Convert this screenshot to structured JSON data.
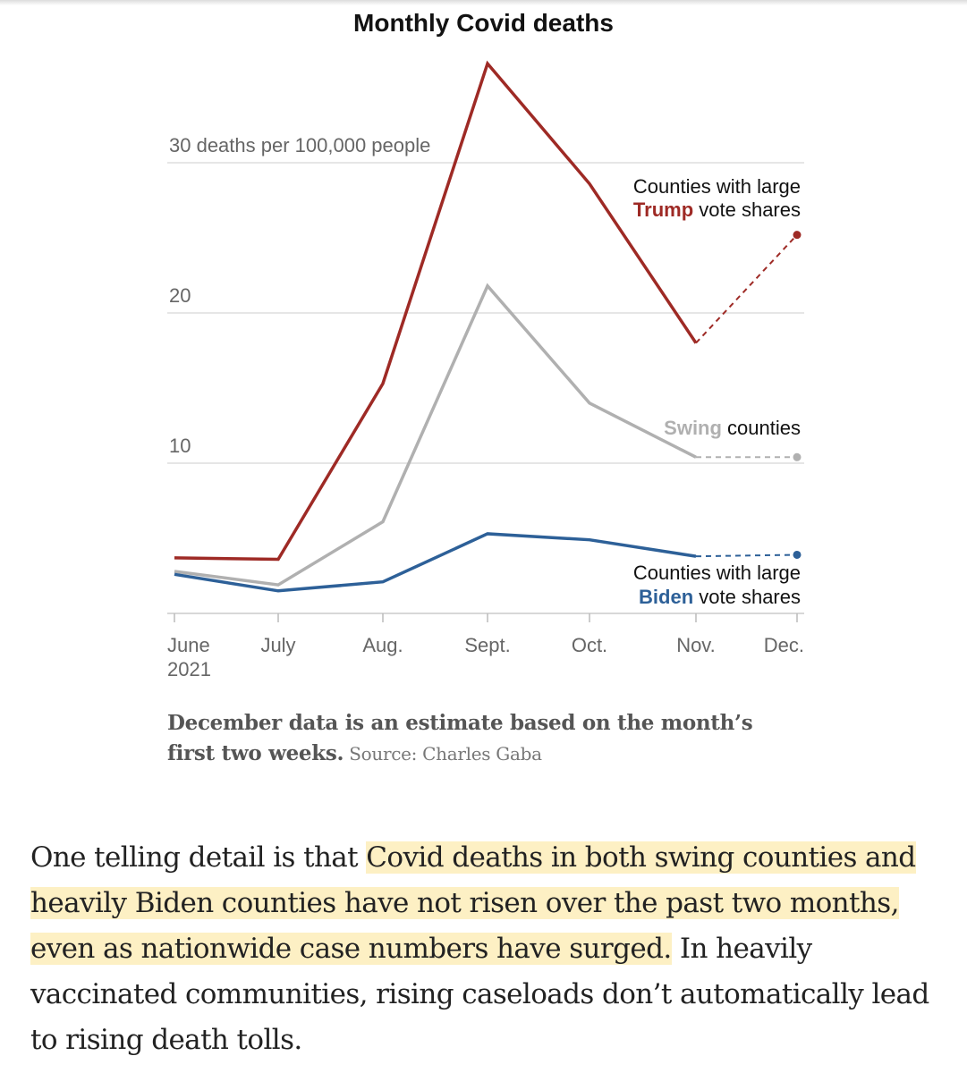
{
  "colors": {
    "trump": "#9e2a25",
    "swing": "#b0b0b0",
    "biden": "#2d6098",
    "grid": "#dddddd",
    "axis_text": "#666666",
    "highlight": "#fdf0c4"
  },
  "chart_data": {
    "type": "line",
    "title": "Monthly Covid deaths",
    "categories": [
      "June 2021",
      "July",
      "Aug.",
      "Sept.",
      "Oct.",
      "Nov.",
      "Dec."
    ],
    "x_tick_labels": [
      [
        "June",
        "2021"
      ],
      [
        "July"
      ],
      [
        "Aug."
      ],
      [
        "Sept."
      ],
      [
        "Oct."
      ],
      [
        "Nov."
      ],
      [
        "Dec."
      ]
    ],
    "y_ticks": [
      {
        "value": 10,
        "label": "10"
      },
      {
        "value": 20,
        "label": "20"
      },
      {
        "value": 30,
        "label": "30 deaths per 100,000 people"
      }
    ],
    "ylim": [
      0,
      37
    ],
    "grid": true,
    "estimate_note": "Dec. values are estimates (dashed segment)",
    "series": [
      {
        "key": "trump",
        "values": [
          3.7,
          3.6,
          15.3,
          36.6,
          28.6,
          18.0,
          25.2
        ],
        "label_lines": [
          [
            {
              "text": "Counties with large",
              "bold": false,
              "color": "#121212"
            }
          ],
          [
            {
              "text": "Trump",
              "bold": true,
              "color": "#9e2a25"
            },
            {
              "text": " vote shares",
              "bold": false,
              "color": "#121212"
            }
          ]
        ]
      },
      {
        "key": "swing",
        "values": [
          2.8,
          1.9,
          6.1,
          21.8,
          14.0,
          10.4,
          10.4
        ],
        "label_lines": [
          [
            {
              "text": "Swing",
              "bold": true,
              "color": "#b0b0b0"
            },
            {
              "text": " counties",
              "bold": false,
              "color": "#121212"
            }
          ]
        ]
      },
      {
        "key": "biden",
        "values": [
          2.6,
          1.5,
          2.1,
          5.3,
          4.9,
          3.8,
          3.9
        ],
        "label_lines": [
          [
            {
              "text": "Counties with large",
              "bold": false,
              "color": "#121212"
            }
          ],
          [
            {
              "text": "Biden",
              "bold": true,
              "color": "#2d6098"
            },
            {
              "text": " vote shares",
              "bold": false,
              "color": "#121212"
            }
          ]
        ]
      }
    ]
  },
  "caption": {
    "text": "December data is an estimate based on the month’s first two weeks.",
    "source": "Source: Charles Gaba"
  },
  "paragraph": {
    "before": "One telling detail is that ",
    "highlight": "Covid deaths in both swing counties and heavily Biden counties have not risen over the past two months, even as nationwide case numbers have surged.",
    "after": " In heavily vaccinated communities, rising caseloads don’t automatically lead to rising death tolls."
  }
}
